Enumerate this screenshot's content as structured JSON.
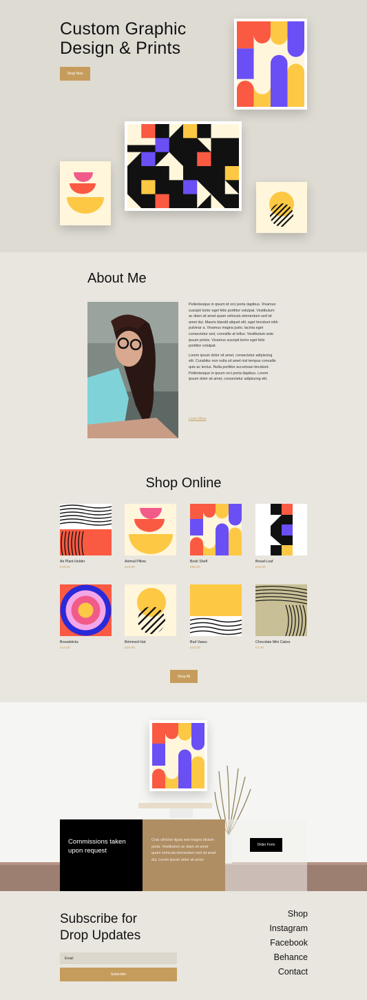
{
  "hero": {
    "title_line1": "Custom Graphic",
    "title_line2": "Design & Prints",
    "cta": "Shop Now"
  },
  "about": {
    "title": "About Me",
    "paragraph1": "Pellentesque in ipsum id orci porta dapibus. Vivamus suscipit tortor eget felis porttitor volutpat. Vestibulum ac diam sit amet quam vehicula elementum sed sit amet dui. Mauris blandit aliquet elit, eget tincidunt nibh pulvinar a. Vivamus magna justo, lacinia eget consectetur sed, convallis at tellus. Vestibulum ante ipsum primis. Vivamus suscipit tortor eget felis porttitor volutpat.",
    "paragraph2": "Lorem ipsum dolor sit amet, consectetur adipiscing elit. Curabitur non nulla sit amet nisl tempus convallis quis ac lectus. Nulla porttitor accumsan tincidunt. Pellentesque in ipsum orci porta dapibus. Lorem ipsum dolor sit amet, consectetur adipiscing elit.",
    "link": "Learn More"
  },
  "shop": {
    "title": "Shop Online",
    "products": [
      {
        "name": "Air Plant Holder",
        "price": "£18.00"
      },
      {
        "name": "Animal Pillow",
        "price": "£28.00"
      },
      {
        "name": "Book Shelf",
        "price": "£89.00"
      },
      {
        "name": "Bread Loaf",
        "price": "£12.00"
      },
      {
        "name": "Breadsticks",
        "price": "£14.00"
      },
      {
        "name": "Brimmed Hat",
        "price": "£25.00"
      },
      {
        "name": "Bud Vases",
        "price": "£22.00"
      },
      {
        "name": "Chocolate Mini Cakes",
        "price": "£7.00"
      }
    ],
    "cta": "Shop All"
  },
  "commissions": {
    "heading": "Commissions taken upon request",
    "body": "Cras ultricies ligula sed magna dictum porta. Vestibulum ac diam sit amet quam vehicula elementum sed sit amet dui. Lorem ipsum dolor sit amet.",
    "cta": "Order Form"
  },
  "footer": {
    "subscribe_title_line1": "Subscribe for",
    "subscribe_title_line2": "Drop Updates",
    "email_placeholder": "Email",
    "subscribe_cta": "Subscribe",
    "links": [
      "Shop",
      "Instagram",
      "Facebook",
      "Behance",
      "Contact"
    ]
  },
  "colors": {
    "accent_gold": "#c69c5c",
    "art_red": "#fa5a42",
    "art_purple": "#6a4ff5",
    "art_yellow": "#fdc844",
    "art_cream": "#fff6dc",
    "art_pink": "#f15b8a"
  }
}
